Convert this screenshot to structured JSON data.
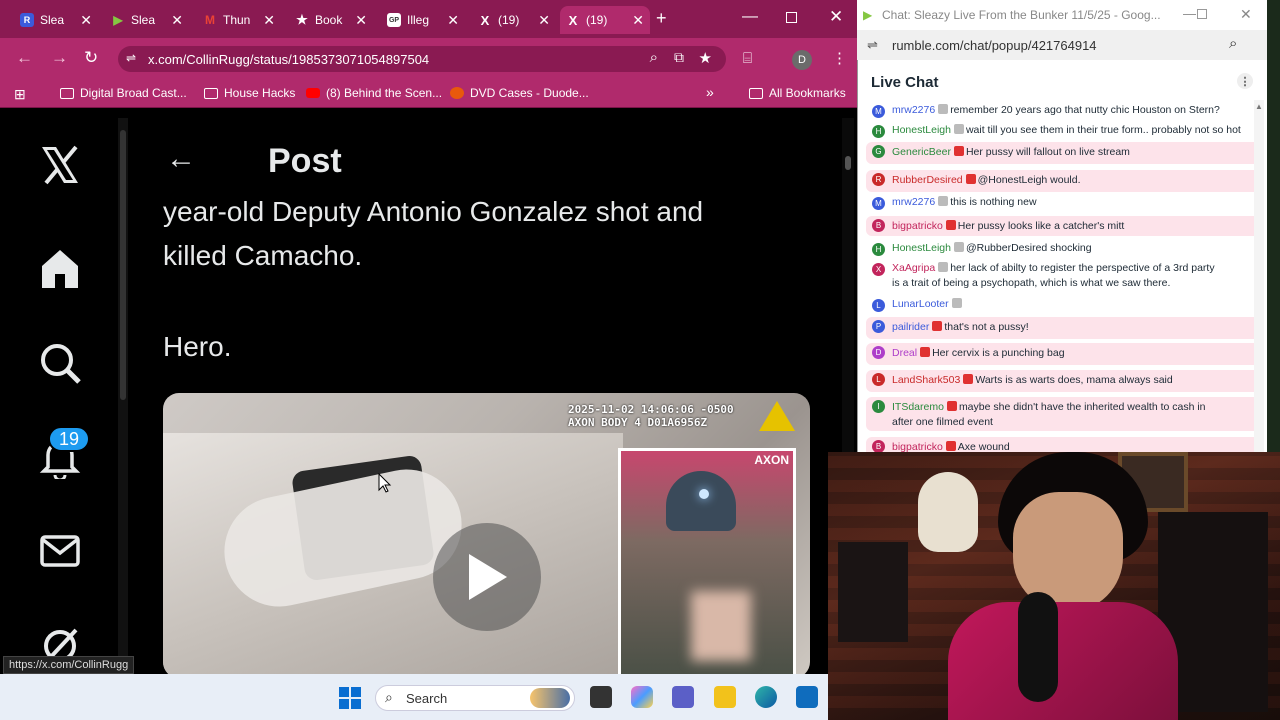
{
  "browser": {
    "tabs": [
      {
        "label": "Slea",
        "favicon": "R",
        "color": "#3b5bdb"
      },
      {
        "label": "Slea",
        "favicon": "▶",
        "color": "#85c742"
      },
      {
        "label": "Thun",
        "favicon": "M",
        "color": "#ea4335"
      },
      {
        "label": "Book",
        "favicon": "★",
        "color": "#ffffff"
      },
      {
        "label": "Illeg",
        "favicon": "GP",
        "color": "#ffffff"
      },
      {
        "label": "(19)",
        "favicon": "X",
        "color": "#000000"
      },
      {
        "label": "(19)",
        "favicon": "X",
        "color": "#000000"
      }
    ],
    "url": "x.com/CollinRugg/status/1985373071054897504",
    "profile_initial": "D",
    "bookmarks": [
      {
        "label": "Digital Broad Cast..."
      },
      {
        "label": "House Hacks"
      },
      {
        "label": "(8) Behind the Scen..."
      },
      {
        "label": "DVD Cases - Duode..."
      }
    ],
    "all_bookmarks": "All Bookmarks",
    "status_url": "https://x.com/CollinRugg"
  },
  "xpage": {
    "header_title": "Post",
    "text_line1": "year-old Deputy Antonio Gonzalez shot and",
    "text_line2": "killed Camacho.",
    "text_line3": "Hero.",
    "notification_count": "19",
    "video_overlay_line1": "2025-11-02 14:06:06 -0500",
    "video_overlay_line2": "AXON BODY 4 D01A6956Z",
    "video_inset_label": "AXON"
  },
  "taskbar": {
    "search_placeholder": "Search"
  },
  "chat": {
    "window_title": "Chat: Sleazy Live From the Bunker 11/5/25 - Goog...",
    "url": "rumble.com/chat/popup/421764914",
    "header": "Live Chat",
    "messages": [
      {
        "user": "mrw2276",
        "text": "remember 20 years ago that nutty chic Houston on Stern?",
        "color": "#3b5bdb",
        "initial": "M",
        "hl": false
      },
      {
        "user": "HonestLeigh",
        "text": "wait till you see them in their true form.. probably not so hot",
        "color": "#2b8a3e",
        "initial": "H",
        "hl": false
      },
      {
        "user": "GenericBeer",
        "text": "Her pussy will fallout on live stream",
        "color": "#2b8a3e",
        "initial": "G",
        "hl": true
      },
      {
        "user": "RubberDesired",
        "text": "@HonestLeigh would.",
        "color": "#c92a2a",
        "initial": "R",
        "hl": true
      },
      {
        "user": "mrw2276",
        "text": "this is nothing new",
        "color": "#3b5bdb",
        "initial": "M",
        "hl": false
      },
      {
        "user": "bigpatricko",
        "text": "Her pussy looks like a catcher's mitt",
        "color": "#c2255c",
        "initial": "B",
        "hl": true
      },
      {
        "user": "HonestLeigh",
        "text": "@RubberDesired shocking",
        "color": "#2b8a3e",
        "initial": "H",
        "hl": false
      },
      {
        "user": "XaAgripa",
        "text": "her lack of abilty to register the perspective of a 3rd party",
        "text2": "is a trait of being a psychopath, which is what we saw there.",
        "color": "#c2255c",
        "initial": "X",
        "hl": false
      },
      {
        "user": "LunarLooter",
        "text": "",
        "color": "#3b5bdb",
        "initial": "L",
        "hl": false
      },
      {
        "user": "pailrider",
        "text": "that's not a pussy!",
        "color": "#3b5bdb",
        "initial": "P",
        "hl": true
      },
      {
        "user": "Dreal",
        "text": "Her cervix is a punching bag",
        "color": "#ae3ec9",
        "initial": "D",
        "hl": true
      },
      {
        "user": "LandShark503",
        "text": "Warts is as warts does, mama always said",
        "color": "#c92a2a",
        "initial": "L",
        "hl": true
      },
      {
        "user": "ITSdaremo",
        "text": "maybe she didn't have the inherited wealth to cash in",
        "text2": "after one filmed event",
        "color": "#2b8a3e",
        "initial": "I",
        "hl": true
      },
      {
        "user": "bigpatricko",
        "text": "Axe wound",
        "color": "#c2255c",
        "initial": "B",
        "hl": true
      }
    ]
  }
}
